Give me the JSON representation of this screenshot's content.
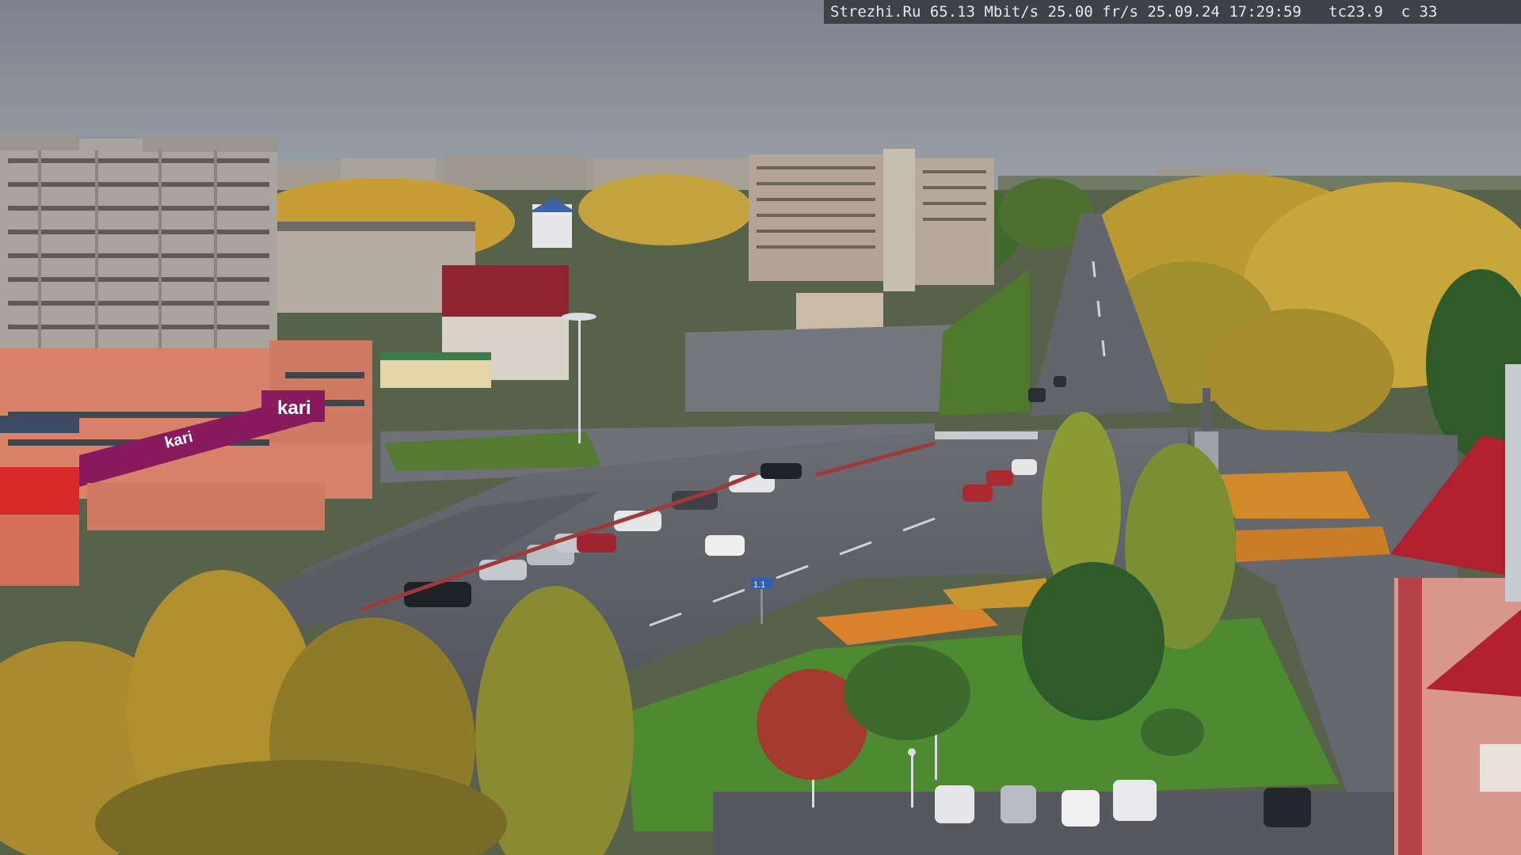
{
  "osd": {
    "text": "Strezhi.Ru 65.13 Mbit/s 25.00 fr/s 25.09.24 17:29:59   tc23.9  c 33"
  },
  "signs": {
    "kari_large": "kari",
    "kari_small": "kari",
    "road_sign": "1.1"
  },
  "colors": {
    "sky": "#8a919c",
    "asphalt": "#5c6066",
    "grass": "#4f7a2e",
    "brand_magenta": "#8a1a5e",
    "roof_red": "#b0202e",
    "autumn_yellow": "#c9a23a"
  }
}
